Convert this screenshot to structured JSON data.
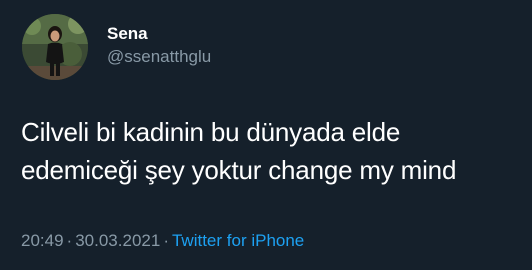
{
  "author": {
    "display_name": "Sena",
    "handle": "@ssenatthglu"
  },
  "tweet": {
    "lines": [
      "Cilveli bi kadinin bu dünyada elde",
      "edemiceği şey yoktur change my mind"
    ]
  },
  "meta": {
    "time": "20:49",
    "separator": "·",
    "date": "30.03.2021",
    "source": "Twitter for iPhone"
  },
  "colors": {
    "background": "#15202b",
    "primary_text": "#ffffff",
    "secondary_text": "#8899a6",
    "link": "#1da1f2"
  }
}
